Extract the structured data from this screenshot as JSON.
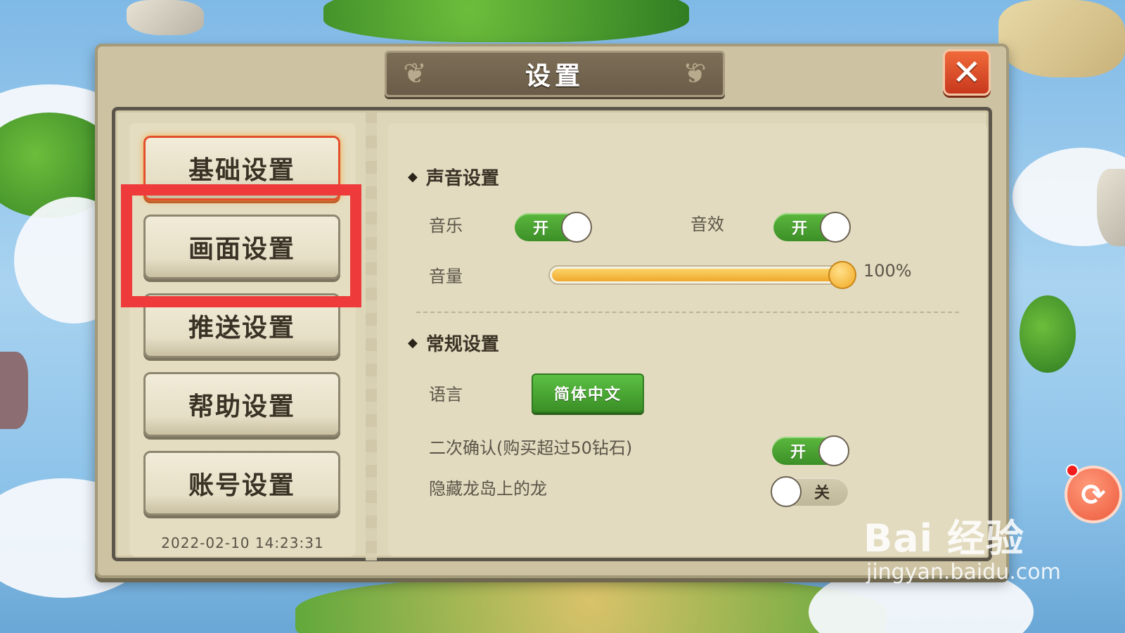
{
  "dialog": {
    "title": "设置",
    "close_icon": "close-icon"
  },
  "nav": {
    "items": [
      {
        "label": "基础设置",
        "active": true
      },
      {
        "label": "画面设置",
        "active": false
      },
      {
        "label": "推送设置",
        "active": false
      },
      {
        "label": "帮助设置",
        "active": false
      },
      {
        "label": "账号设置",
        "active": false
      }
    ],
    "timestamp": "2022-02-10 14:23:31"
  },
  "sound": {
    "title": "声音设置",
    "music_label": "音乐",
    "music_toggle": "开",
    "sfx_label": "音效",
    "sfx_toggle": "开",
    "volume_label": "音量",
    "volume_value": 1.0,
    "volume_text": "100%"
  },
  "general": {
    "title": "常规设置",
    "language_label": "语言",
    "language_value": "简体中文",
    "confirm_label": "二次确认(购买超过50钻石)",
    "confirm_toggle": "开",
    "hide_dragon_label": "隐藏龙岛上的龙",
    "hide_dragon_toggle": "关"
  },
  "colors": {
    "highlight": "#ee3a3a",
    "toggle_on": "#4aa832",
    "accent_orange": "#f0a82a"
  },
  "watermark": {
    "line1": "Bai 经验",
    "line2": "jingyan.baidu.com"
  },
  "overlay": {
    "refresh_icon": "refresh-icon"
  }
}
